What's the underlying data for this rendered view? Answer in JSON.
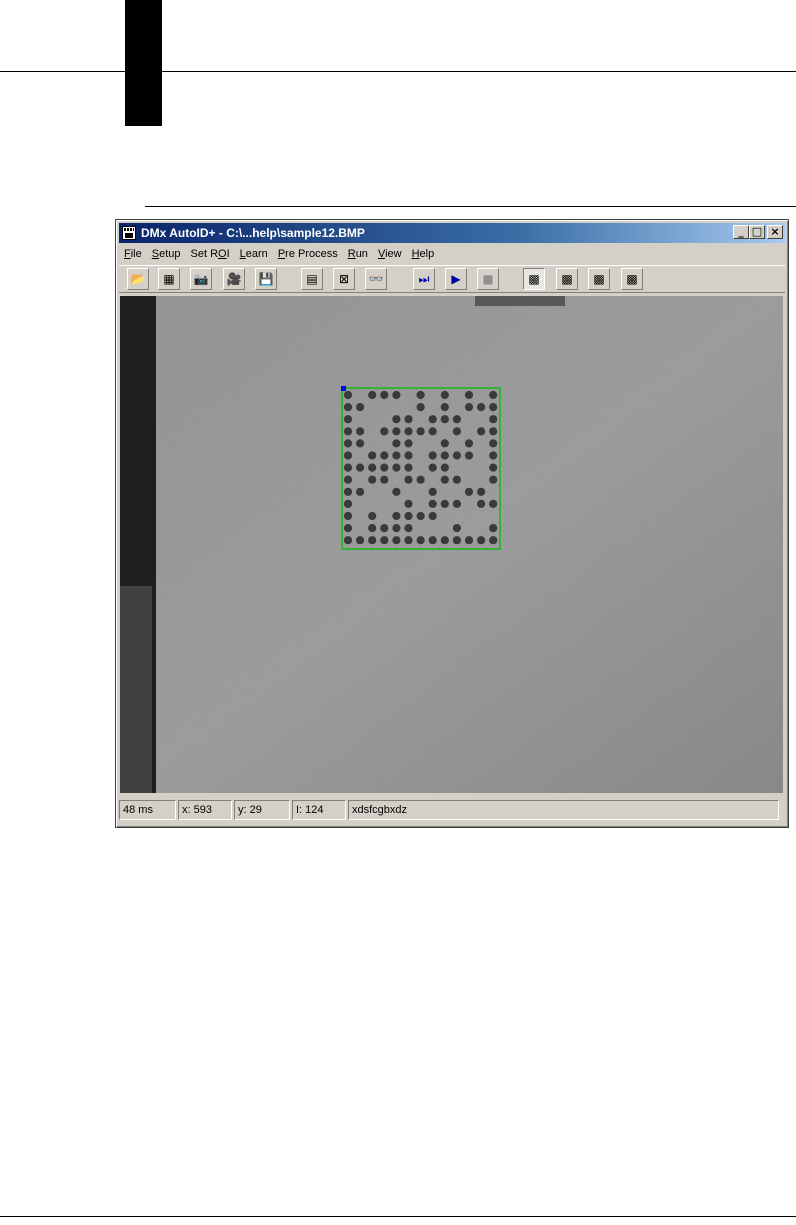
{
  "window": {
    "title": "DMx AutoID+ - C:\\...help\\sample12.BMP",
    "buttons": {
      "minimize": "_",
      "maximize": "□",
      "close": "×"
    }
  },
  "menu": {
    "items": [
      {
        "label": "File",
        "mnemonic": "F"
      },
      {
        "label": "Setup",
        "mnemonic": "S"
      },
      {
        "label": "Set ROI",
        "mnemonic": "O"
      },
      {
        "label": "Learn",
        "mnemonic": "L"
      },
      {
        "label": "Pre Process",
        "mnemonic": "P"
      },
      {
        "label": "Run",
        "mnemonic": "R"
      },
      {
        "label": "View",
        "mnemonic": "V"
      },
      {
        "label": "Help",
        "mnemonic": "H"
      }
    ]
  },
  "toolbar": {
    "buttons": [
      {
        "name": "open-file-icon",
        "glyph": "📂",
        "state": "normal"
      },
      {
        "name": "grid-icon",
        "glyph": "▦",
        "state": "normal"
      },
      {
        "name": "camera-icon",
        "glyph": "📷",
        "state": "normal"
      },
      {
        "name": "video-camera-icon",
        "glyph": "🎥",
        "state": "normal"
      },
      {
        "name": "save-icon",
        "glyph": "💾",
        "state": "normal"
      },
      {
        "name": "properties-icon",
        "glyph": "▤",
        "state": "normal"
      },
      {
        "name": "roi-icon",
        "glyph": "⊠",
        "state": "normal"
      },
      {
        "name": "glasses-icon",
        "glyph": "👓",
        "state": "normal"
      },
      {
        "name": "step-icon",
        "glyph": "⏭",
        "state": "normal"
      },
      {
        "name": "run-icon",
        "glyph": "▶",
        "state": "normal"
      },
      {
        "name": "stop-icon",
        "glyph": "■",
        "state": "disabled"
      },
      {
        "name": "decode-mode-1-icon",
        "glyph": "▩",
        "state": "pressed"
      },
      {
        "name": "decode-mode-2-icon",
        "glyph": "▩",
        "state": "normal"
      },
      {
        "name": "decode-mode-3-icon",
        "glyph": "▩",
        "state": "normal"
      },
      {
        "name": "decode-mode-4-icon",
        "glyph": "▩",
        "state": "normal"
      }
    ]
  },
  "status": {
    "time": "48 ms",
    "x": "x: 593",
    "y": "y: 29",
    "intensity": "I: 124",
    "decoded": "xdsfcgbxdz"
  },
  "colors": {
    "roi_box": "#00c000",
    "roi_handle": "#0000ff"
  }
}
